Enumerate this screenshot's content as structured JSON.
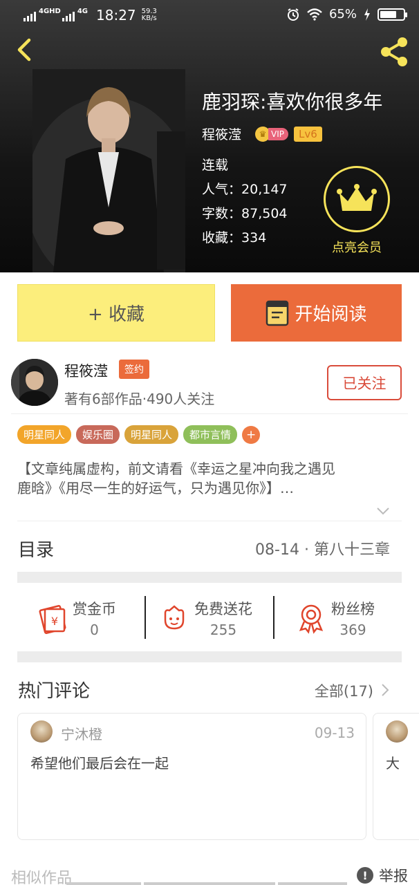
{
  "status_bar": {
    "network_1": "4GHD",
    "network_2": "4G",
    "time": "18:27",
    "speed_value": "59.3",
    "speed_unit": "KB/s",
    "battery": "65%",
    "battery_level": 0.65
  },
  "header": {
    "back_icon": "chevron-left-icon",
    "share_icon": "share-icon",
    "accent_color": "#f6e35a"
  },
  "book": {
    "title": "鹿羽琛:喜欢你很多年",
    "author": "程筱滢",
    "vip_label": "VIP",
    "level": "Lv6",
    "status": "连载",
    "popularity_label": "人气：",
    "popularity": "20,147",
    "words_label": "字数：",
    "words": "87,504",
    "favorites_label": "收藏：",
    "favorites": "334",
    "member_label": "点亮会员"
  },
  "actions": {
    "favorite": "+ 收藏",
    "read": "开始阅读",
    "favorite_color": "#fcee7c",
    "read_color": "#eb6b3b"
  },
  "author_info": {
    "name": "程筱滢",
    "badge": "签约",
    "works": "著有6部作品",
    "dot": "·",
    "followers": "490人关注",
    "follow_button": "已关注"
  },
  "tags": [
    {
      "label": "明星同人",
      "color": "#f2a52a"
    },
    {
      "label": "娱乐圈",
      "color": "#c8695a"
    },
    {
      "label": "明星同人",
      "color": "#d9a33a"
    },
    {
      "label": "都市言情",
      "color": "#8fbf5a"
    }
  ],
  "tag_more": "+",
  "description": {
    "line1": "【文章纯属虚构，前文请看《幸运之星冲向我之遇见",
    "line2": "鹿晗》《用尽一生的好运气，只为遇见你》】…"
  },
  "toc": {
    "title": "目录",
    "latest_date": "08-14",
    "dot": "·",
    "latest_chapter": "第八十三章"
  },
  "rewards": [
    {
      "label": "赏金币",
      "value": "0",
      "icon": "red-envelope-icon"
    },
    {
      "label": "免费送花",
      "value": "255",
      "icon": "flower-icon"
    },
    {
      "label": "粉丝榜",
      "value": "369",
      "icon": "medal-icon"
    }
  ],
  "comments": {
    "title": "热门评论",
    "all_label": "全部(17)",
    "items": [
      {
        "user": "宁沐橙",
        "date": "09-13",
        "text": "希望他们最后会在一起"
      },
      {
        "text": "大"
      }
    ]
  },
  "footer": {
    "similar": "相似作品",
    "report": "举报",
    "report_icon": "!"
  }
}
